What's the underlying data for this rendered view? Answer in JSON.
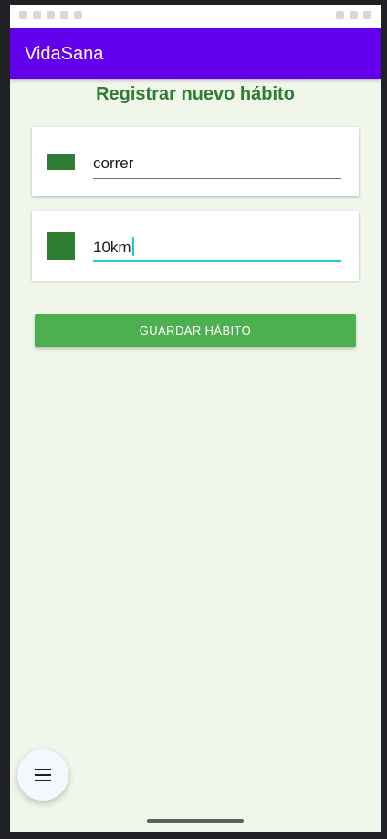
{
  "app": {
    "title": "VidaSana"
  },
  "page": {
    "title": "Registrar nuevo hábito"
  },
  "form": {
    "habit_name_value": "correr",
    "habit_detail_value": "10km",
    "save_label": "GUARDAR HÁBITO"
  },
  "icons": {
    "fab": "menu-icon",
    "habit_name_swatch": "green-swatch-icon",
    "habit_detail_swatch": "green-swatch-icon"
  },
  "colors": {
    "app_bar": "#6200ee",
    "accent_green": "#2e7d32",
    "button_green": "#4caf50",
    "focus_cyan": "#26c6da",
    "background": "#f1f6ea"
  }
}
